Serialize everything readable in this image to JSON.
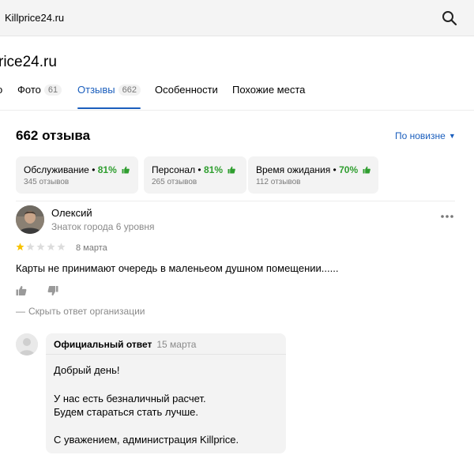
{
  "search": {
    "query": "Killprice24.ru"
  },
  "org": {
    "title_visible": "rice24.ru"
  },
  "tabs": [
    {
      "label": "Фото",
      "count": "61"
    },
    {
      "label": "Отзывы",
      "count": "662"
    },
    {
      "label": "Особенности"
    },
    {
      "label": "Похожие места"
    }
  ],
  "reviews": {
    "heading": "662 отзыва",
    "sort_label": "По новизне",
    "sort_caret": "▼"
  },
  "aspects": [
    {
      "name": "Обслуживание",
      "sep": " • ",
      "percent": "81%",
      "sub": "345 отзывов"
    },
    {
      "name": "Персонал",
      "sep": " • ",
      "percent": "81%",
      "sub": "265 отзывов"
    },
    {
      "name": "Время ожидания",
      "sep": " • ",
      "percent": "70%",
      "sub": "112 отзывов"
    }
  ],
  "review": {
    "author": "Олексий",
    "level": "Знаток города 6 уровня",
    "rating": 1,
    "rating_max": 5,
    "date": "8 марта",
    "text": "Карты не принимают очередь в маленьеом душном помещении......",
    "hide_reply_dash": "—",
    "hide_reply": "Скрыть ответ организации"
  },
  "reply": {
    "label": "Официальный ответ",
    "date": "15 марта",
    "lines": [
      "Добрый день!",
      "У нас есть безналичный расчет.",
      "Будем стараться стать лучше.",
      "С уважением, администрация Killprice."
    ]
  },
  "colors": {
    "accent": "#1a5ebd",
    "positive": "#2f9e2f",
    "star_active": "#f7c200",
    "star_inactive": "#dcdcdc"
  },
  "icons": [
    "search-icon",
    "thumb-up-icon",
    "more-icon",
    "like-icon",
    "dislike-icon",
    "avatar",
    "org-avatar"
  ]
}
